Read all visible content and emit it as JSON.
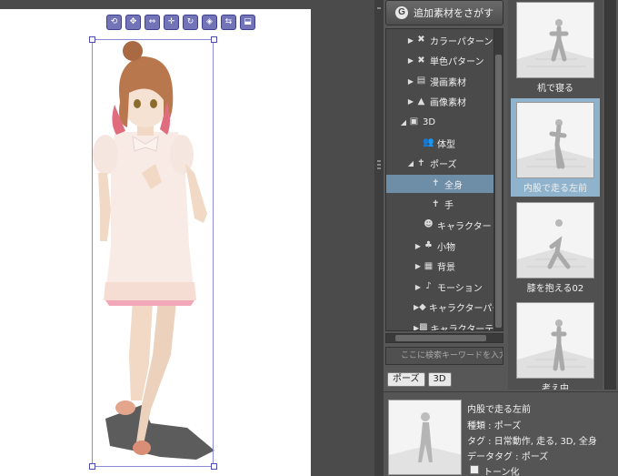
{
  "search_button": {
    "label": "追加素材をさがす",
    "icon": "search-magnify-icon"
  },
  "tree": [
    {
      "label": "カラーパターン",
      "indent": 1,
      "arrow": "▶",
      "icon": "✖"
    },
    {
      "label": "単色パターン",
      "indent": 1,
      "arrow": "▶",
      "icon": "✖"
    },
    {
      "label": "漫画素材",
      "indent": 1,
      "arrow": "▶",
      "icon": "▤"
    },
    {
      "label": "画像素材",
      "indent": 1,
      "arrow": "▶",
      "icon": "▲"
    },
    {
      "label": "3D",
      "indent": 0,
      "arrow": "◢",
      "icon": "▣"
    },
    {
      "label": "体型",
      "indent": 2,
      "arrow": "",
      "icon": "👥"
    },
    {
      "label": "ポーズ",
      "indent": 1,
      "arrow": "◢",
      "icon": "✝"
    },
    {
      "label": "全身",
      "indent": 3,
      "arrow": "",
      "icon": "✝",
      "selected": true
    },
    {
      "label": "手",
      "indent": 3,
      "arrow": "",
      "icon": "✝"
    },
    {
      "label": "キャラクター",
      "indent": 2,
      "arrow": "",
      "icon": "☻"
    },
    {
      "label": "小物",
      "indent": 2,
      "arrow": "▶",
      "icon": "♣"
    },
    {
      "label": "背景",
      "indent": 2,
      "arrow": "▶",
      "icon": "▦"
    },
    {
      "label": "モーション",
      "indent": 2,
      "arrow": "▶",
      "icon": "♪"
    },
    {
      "label": "キャラクターパーツ",
      "indent": 2,
      "arrow": "▶",
      "icon": "◆"
    },
    {
      "label": "キャラクターテクスチャ",
      "indent": 2,
      "arrow": "▶",
      "icon": "▩"
    }
  ],
  "keyword_placeholder": "ここに検索キーワードを入力して",
  "tags": [
    "ポーズ",
    "3D"
  ],
  "thumbnails": [
    {
      "label": "机で寝る",
      "selected": false
    },
    {
      "label": "内股で走る左前",
      "selected": true
    },
    {
      "label": "膝を抱える02",
      "selected": false
    },
    {
      "label": "考え中",
      "selected": false
    }
  ],
  "detail": {
    "title": "内股で走る左前",
    "kind": "種類 : ポーズ",
    "tags": "タグ : 日常動作, 走る, 3D, 全身",
    "data_tags": "データタグ : ポーズ",
    "tone_label": "トーン化"
  },
  "colors": {
    "panel_bg": "#575757",
    "selection": "#6e8ea8",
    "thumb_selection": "#8fb3cc",
    "bbox": "#8b8bd6"
  }
}
